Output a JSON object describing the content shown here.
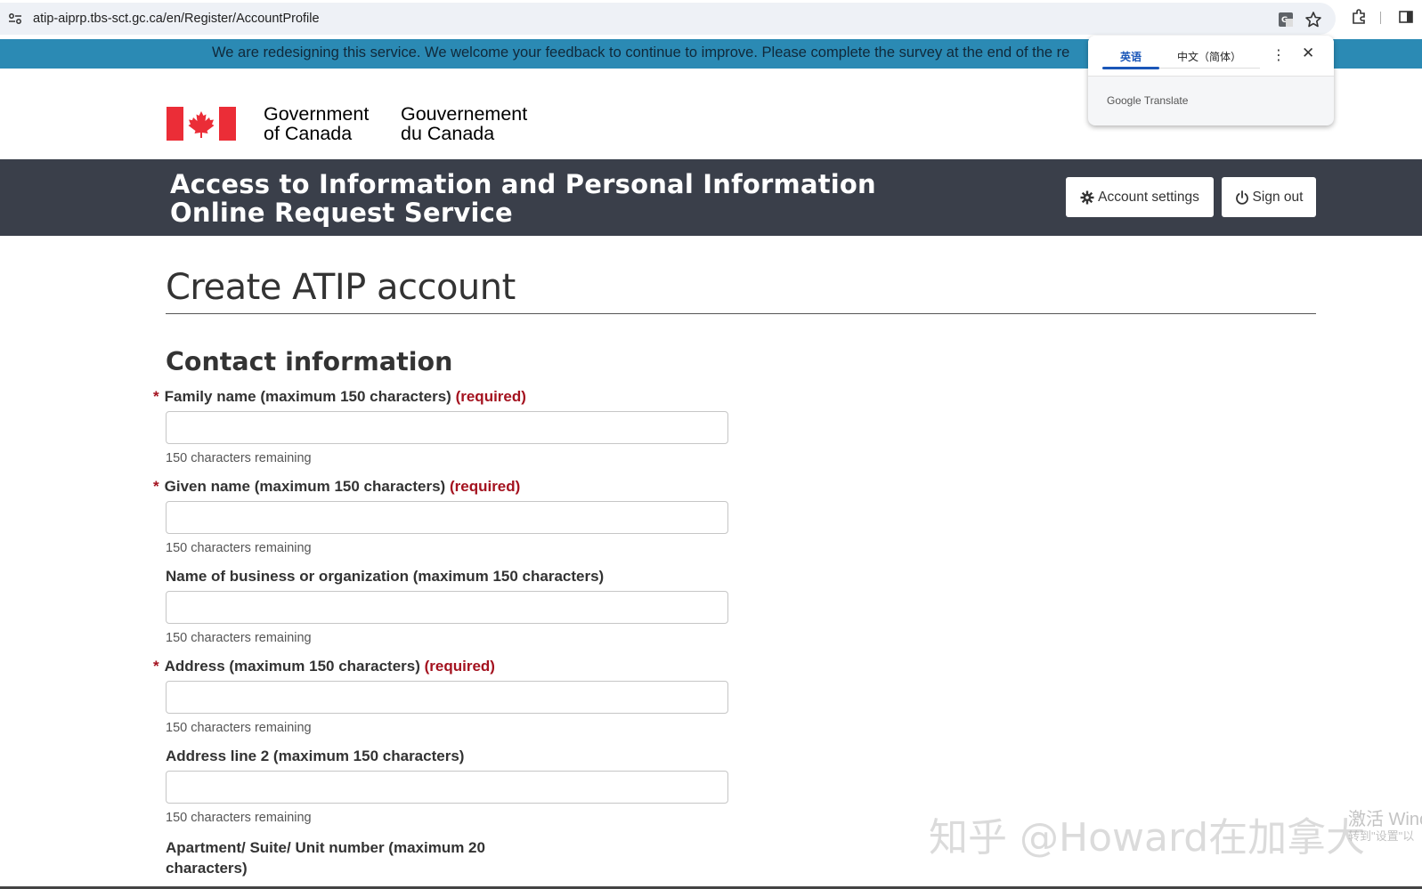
{
  "browser": {
    "url": "atip-aiprp.tbs-sct.gc.ca/en/Register/AccountProfile"
  },
  "notice": {
    "text": "We are redesigning this service. We welcome your feedback to continue to improve. Please complete the survey at the end of the re"
  },
  "translate_popup": {
    "tab_source": "英语",
    "tab_target": "中文（简体）",
    "brand": "Google Translate"
  },
  "gc_header": {
    "en_line1": "Government",
    "en_line2": "of Canada",
    "fr_line1": "Gouvernement",
    "fr_line2": "du Canada"
  },
  "app_bar": {
    "title_line1": "Access to Information and Personal Information",
    "title_line2": "Online Request Service",
    "account_settings": "Account settings",
    "sign_out": "Sign out"
  },
  "page": {
    "title": "Create ATIP account",
    "section": "Contact information",
    "required_text": "(required)",
    "required_marker": "*",
    "fields": [
      {
        "label": "Family name (maximum 150 characters)",
        "required": true,
        "help": "150 characters remaining"
      },
      {
        "label": "Given name (maximum 150 characters)",
        "required": true,
        "help": "150 characters remaining"
      },
      {
        "label": "Name of business or organization (maximum 150 characters)",
        "required": false,
        "help": "150 characters remaining"
      },
      {
        "label": "Address (maximum 150 characters)",
        "required": true,
        "help": "150 characters remaining"
      },
      {
        "label": "Address line 2 (maximum 150 characters)",
        "required": false,
        "help": "150 characters remaining"
      },
      {
        "label": "Apartment/ Suite/ Unit number (maximum 20 characters)",
        "required": false
      }
    ]
  },
  "overlay": {
    "watermark": "知乎 @Howard在加拿大",
    "win_activate": "激活 Winc",
    "win_activate_sub": "转到\"设置\"以"
  }
}
